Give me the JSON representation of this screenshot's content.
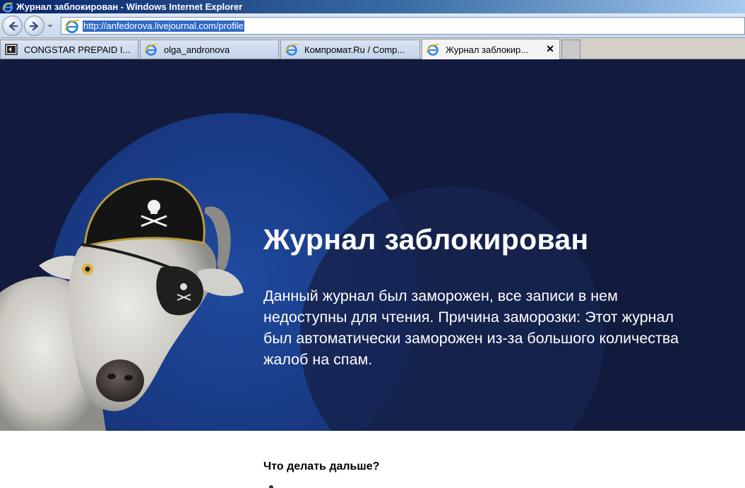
{
  "window": {
    "title": "Журнал заблокирован - Windows Internet Explorer"
  },
  "navbar": {
    "url": "http://anfedorova.livejournal.com/profile",
    "back_icon": "back-arrow-icon",
    "forward_icon": "forward-arrow-icon"
  },
  "tabs": [
    {
      "label": "CONGSTAR PREPAID I...",
      "icon": "page-icon",
      "active": false
    },
    {
      "label": "olga_andronova",
      "icon": "ie-icon",
      "active": false
    },
    {
      "label": "Компромат.Ru / Comp...",
      "icon": "ie-icon",
      "active": false
    },
    {
      "label": "Журнал заблокир...",
      "icon": "ie-icon",
      "active": true
    }
  ],
  "tab_close_glyph": "✕",
  "hero": {
    "title": "Журнал заблокирован",
    "message": "Данный журнал был заморожен, все записи в нем недоступны для чтения. Причина заморозки: Этот журнал был автоматически заморожен из-за большого количества жалоб на спам."
  },
  "next_steps": {
    "heading": "Что делать дальше?"
  },
  "colors": {
    "hero_background": "#121b3d",
    "hero_circle": "#1c3f8c",
    "title_bar": "#0a246a",
    "url_highlight": "#316ac5"
  }
}
